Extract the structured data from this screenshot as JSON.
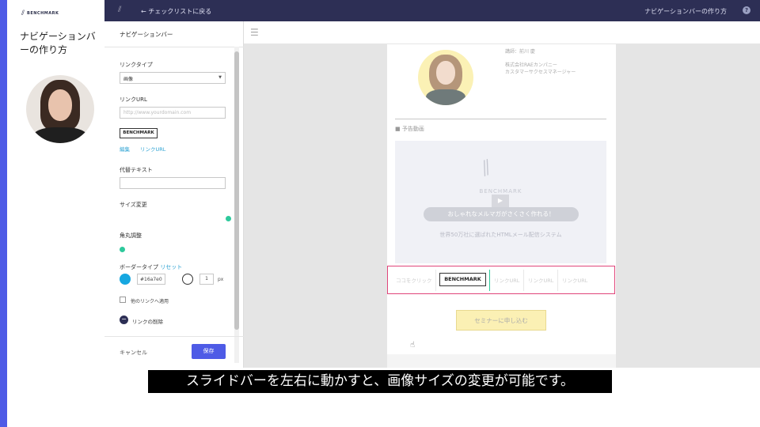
{
  "brand": {
    "name": "BENCHMARK"
  },
  "lesson": {
    "title": "ナビゲーションバーの作り方"
  },
  "topbar": {
    "back_label": "← チェックリストに戻る",
    "page_name": "ナビゲーションバーの作り方",
    "help": "?"
  },
  "panel": {
    "title": "ナビゲーションバー",
    "link_type_label": "リンクタイプ",
    "link_type_value": "画像",
    "link_url_label": "リンクURL",
    "link_url_placeholder": "http://www.yourdomain.com",
    "image_logo_text": "BENCHMARK",
    "edit_link": "編集",
    "link_url_link": "リンクURL",
    "alt_text_label": "代替テキスト",
    "size_change_label": "サイズ変更",
    "corner_label": "角丸調整",
    "border_type_label": "ボーダータイプ",
    "reset_link": "リセット",
    "border_color": "#16a7e0",
    "border_width": "1",
    "border_unit": "px",
    "apply_other_label": "他のリンクへ適用",
    "remove_link_label": "リンクの削除",
    "cancel_label": "キャンセル",
    "save_label": "保存"
  },
  "email": {
    "speaker_name": "講師：前川 慶",
    "speaker_company": "株式会社RAEカンパニー",
    "speaker_role": "カスタマーサクセスマネージャー",
    "section_heading": "■ 予告動画",
    "video_logo": "BENCHMARK",
    "video_pill": "おしゃれなメルマガがさくさく作れる！",
    "video_sub": "世界50万社に選ばれたHTMLメール配信システム",
    "seminar_button": "セミナーに申し込む"
  },
  "navbar": {
    "items": [
      "ココをクリック",
      "BENCHMARK",
      "リンクURL",
      "リンクURL",
      "リンクURL"
    ]
  },
  "subtitle": "スライドバーを左右に動かすと、画像サイズの変更が可能です。",
  "colors": {
    "accent": "#4e5be6",
    "topbar": "#2d2f55",
    "highlight": "#e0457a",
    "toggle": "#2ec99c"
  }
}
